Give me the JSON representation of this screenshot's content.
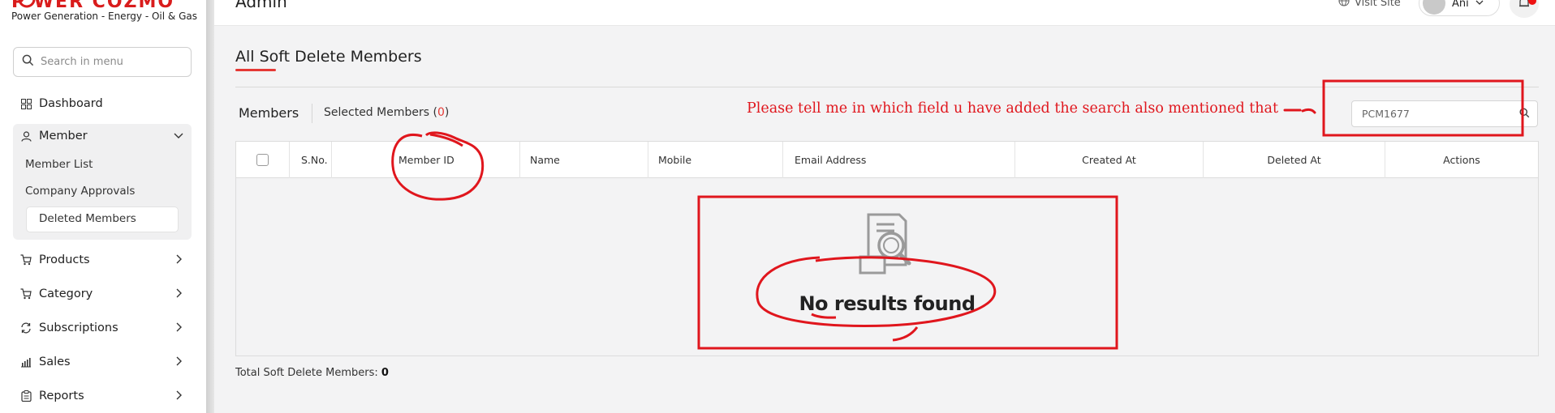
{
  "sidebar": {
    "logo_text": "P WER COZMO",
    "logo_tagline": "Power Generation - Energy - Oil & Gas",
    "search_placeholder": "Search in menu",
    "items": [
      {
        "label": "Dashboard",
        "icon": "grid-icon"
      },
      {
        "label": "Member",
        "icon": "user-icon",
        "expanded": true,
        "children": [
          "Member List",
          "Company Approvals",
          "Deleted Members"
        ],
        "active_child": "Deleted Members"
      },
      {
        "label": "Products",
        "icon": "cart-icon"
      },
      {
        "label": "Category",
        "icon": "cart-icon"
      },
      {
        "label": "Subscriptions",
        "icon": "refresh-icon"
      },
      {
        "label": "Sales",
        "icon": "bar-chart-icon"
      },
      {
        "label": "Reports",
        "icon": "clipboard-icon"
      }
    ]
  },
  "header": {
    "title": "Admin",
    "visit_site": "Visit Site",
    "user_name": "Ani"
  },
  "page": {
    "title": "All Soft Delete Members",
    "tabs": {
      "members": "Members",
      "selected_label": "Selected Members (",
      "selected_count": "0",
      "selected_close": ")"
    },
    "search_value": "PCM1677",
    "annotation": "Please tell me in which field u have added the search also mentioned that",
    "columns": [
      "S.No.",
      "Member ID",
      "Name",
      "Mobile",
      "Email Address",
      "Created At",
      "Deleted At",
      "Actions"
    ],
    "empty_message": "No results found",
    "footer_label": "Total Soft Delete Members: ",
    "footer_count": "0"
  },
  "colors": {
    "accent": "#e53935",
    "annotation": "#e0161d"
  }
}
